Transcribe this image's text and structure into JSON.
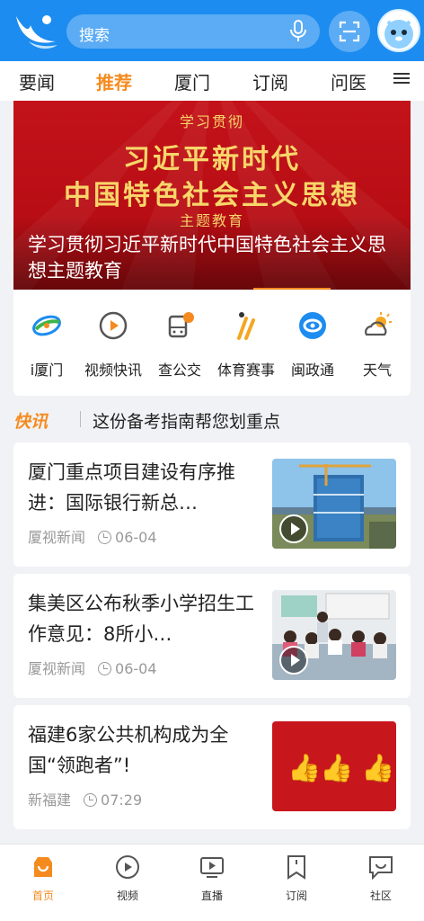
{
  "header": {
    "search_placeholder": "搜索",
    "icons": {
      "logo": "seagull-logo-icon",
      "mic": "microphone-icon",
      "scan": "scan-icon",
      "avatar": "avatar-icon"
    }
  },
  "tabs": [
    {
      "label": "要闻"
    },
    {
      "label": "推荐",
      "active": true
    },
    {
      "label": "厦门"
    },
    {
      "label": "订阅"
    },
    {
      "label": "问医"
    }
  ],
  "banner": {
    "line1": "学习贯彻",
    "line2": "习近平新时代",
    "line3": "中国特色社会主义思想",
    "line4": "主题教育",
    "caption": "学习贯彻习近平新时代中国特色社会主义思想主题教育"
  },
  "quick_access": [
    {
      "label": "i厦门",
      "icon": "i-xiamen-icon"
    },
    {
      "label": "视频快讯",
      "icon": "video-flash-icon"
    },
    {
      "label": "查公交",
      "icon": "bus-icon"
    },
    {
      "label": "体育赛事",
      "icon": "sports-icon"
    },
    {
      "label": "闽政通",
      "icon": "minzhengtong-icon"
    },
    {
      "label": "天气",
      "icon": "weather-icon"
    }
  ],
  "flash": {
    "logo": "快讯",
    "text": "这份备考指南帮您划重点"
  },
  "news": [
    {
      "title": "厦门重点项目建设有序推进：国际银行新总…",
      "source": "厦视新闻",
      "time": "06-04",
      "video": true
    },
    {
      "title": "集美区公布秋季小学招生工作意见：8所小…",
      "source": "厦视新闻",
      "time": "06-04",
      "video": true
    },
    {
      "title": "福建6家公共机构成为全国“领跑者”!",
      "source": "新福建",
      "time": "07:29",
      "video": false
    }
  ],
  "bottom_nav": [
    {
      "label": "首页",
      "icon": "home-icon",
      "active": true
    },
    {
      "label": "视频",
      "icon": "video-icon"
    },
    {
      "label": "直播",
      "icon": "live-icon"
    },
    {
      "label": "订阅",
      "icon": "subscribe-icon"
    },
    {
      "label": "社区",
      "icon": "community-icon"
    }
  ],
  "colors": {
    "brand_blue": "#1d8cf0",
    "accent_orange": "#f58b1f",
    "banner_red": "#c3121a"
  }
}
